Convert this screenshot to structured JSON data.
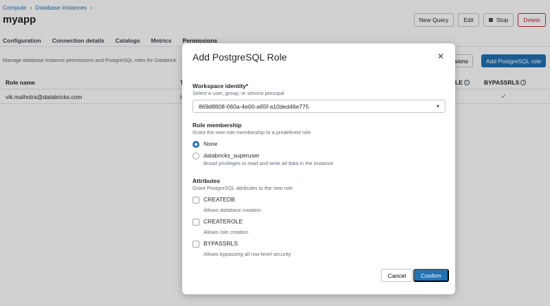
{
  "breadcrumb": {
    "items": [
      "Compute",
      "Database instances"
    ],
    "separator": "›"
  },
  "page": {
    "title": "myapp"
  },
  "toolbar": {
    "new_query": "New Query",
    "edit": "Edit",
    "stop": "Stop",
    "delete": "Delete"
  },
  "tabs": [
    "Configuration",
    "Connection details",
    "Catalogs",
    "Metrics",
    "Permissions"
  ],
  "active_tab": "Permissions",
  "permissions": {
    "description": "Manage database instance permissions and PostgreSQL roles for Databrick",
    "permissions_button_partial": "issions",
    "add_role_button": "Add PostgreSQL role"
  },
  "table": {
    "headers": {
      "role_name": "Role name",
      "col2_partial": "T",
      "createrole_partial": "LE",
      "bypassrls": "BYPASSRLS"
    },
    "rows": [
      {
        "role_name": "vik.malhotra@databricks.com",
        "col2_partial": "t",
        "bypassrls": "✓"
      }
    ]
  },
  "modal": {
    "title": "Add PostgreSQL Role",
    "close_glyph": "✕",
    "workspace_identity": {
      "label": "Workspace identity*",
      "help": "Select a user, group, or service principal",
      "value": "869d8808-060a-4e00-a65f-a10ded46e775"
    },
    "role_membership": {
      "label": "Role membership",
      "help": "Grant the new role membership to a predefined role",
      "options": [
        {
          "label": "None",
          "help": "",
          "checked": true
        },
        {
          "label": "databricks_superuser",
          "help": "Broad privileges to read and write all data in the instance",
          "checked": false
        }
      ]
    },
    "attributes": {
      "label": "Attributes",
      "help": "Grant PostgreSQL attributes to the new role",
      "items": [
        {
          "label": "CREATEDB",
          "help": "Allows database creation",
          "checked": false
        },
        {
          "label": "CREATEROLE",
          "help": "Allows role creation",
          "checked": false
        },
        {
          "label": "BYPASSRLS",
          "help": "Allows bypassing all row-level security",
          "checked": false
        }
      ]
    },
    "cancel": "Cancel",
    "confirm": "Confirm"
  },
  "colors": {
    "primary": "#2272b4",
    "danger": "#c82333",
    "check": "#2e7d4f"
  }
}
